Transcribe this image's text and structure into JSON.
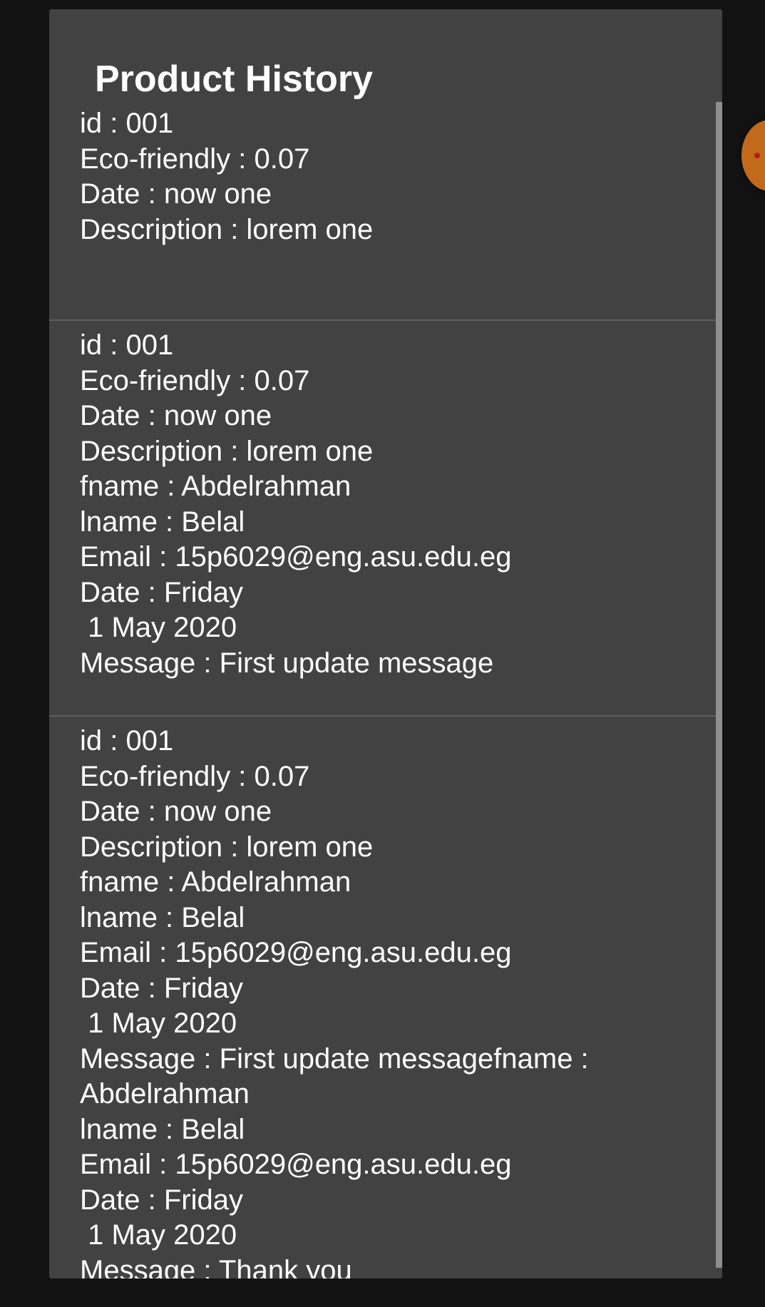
{
  "dialog": {
    "title": "Product History"
  },
  "history": [
    {
      "text": "id : 001\nEco-friendly : 0.07\nDate : now one\nDescription : lorem one"
    },
    {
      "text": "id : 001\nEco-friendly : 0.07\nDate : now one\nDescription : lorem one\nfname : Abdelrahman\nlname : Belal\nEmail : 15p6029@eng.asu.edu.eg\nDate : Friday\n 1 May 2020\nMessage : First update message"
    },
    {
      "text": "id : 001\nEco-friendly : 0.07\nDate : now one\nDescription : lorem one\nfname : Abdelrahman\nlname : Belal\nEmail : 15p6029@eng.asu.edu.eg\nDate : Friday\n 1 May 2020\nMessage : First update messagefname : \nAbdelrahman\nlname : Belal\nEmail : 15p6029@eng.asu.edu.eg\nDate : Friday\n 1 May 2020\nMessage : Thank you"
    }
  ],
  "colors": {
    "background": "#121212",
    "dialog_surface": "#424242",
    "text": "#ffffff",
    "divider": "#5e5e5e",
    "scrollbar": "#8e8e8e",
    "fab_accent": "#c26a19"
  },
  "icons": {
    "background_fab": "partially-visible-orange-fab"
  }
}
